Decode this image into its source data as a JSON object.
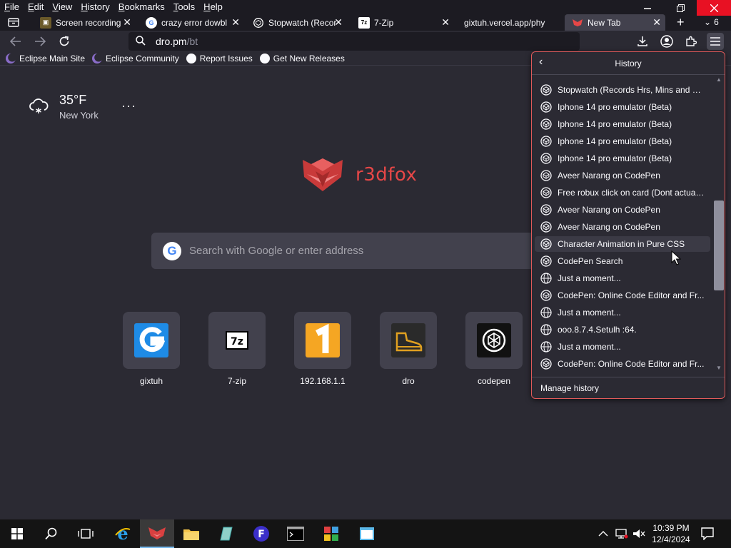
{
  "menu": [
    "File",
    "Edit",
    "View",
    "History",
    "Bookmarks",
    "Tools",
    "Help"
  ],
  "tabs": [
    {
      "title": "Screen recording",
      "icon": "screen-recording-icon"
    },
    {
      "title": "crazy error dowbl",
      "icon": "google-icon"
    },
    {
      "title": "Stopwatch (Recor",
      "icon": "codepen-icon"
    },
    {
      "title": "7-Zip",
      "icon": "7zip-icon"
    },
    {
      "title": "gixtuh.vercel.app/phy",
      "icon": ""
    },
    {
      "title": "New Tab",
      "icon": "r3dfox-icon",
      "active": true
    }
  ],
  "tab_overflow_count": "6",
  "urlbar": {
    "host": "dro.pm",
    "path": "/bt"
  },
  "bookmarks": [
    {
      "label": "Eclipse Main Site",
      "icon": "eclipse-icon"
    },
    {
      "label": "Eclipse Community",
      "icon": "eclipse-icon"
    },
    {
      "label": "Report Issues",
      "icon": "github-icon"
    },
    {
      "label": "Get New Releases",
      "icon": "github-icon"
    }
  ],
  "weather": {
    "temp": "35°F",
    "city": "New York",
    "more": "···"
  },
  "logo_text": "r3dfox",
  "search": {
    "placeholder": "Search with Google or enter address"
  },
  "top_sites": [
    {
      "label": "gixtuh",
      "icon": "gixtuh-icon"
    },
    {
      "label": "7-zip",
      "icon": "7zip-icon"
    },
    {
      "label": "192.168.1.1",
      "icon": "number-one-icon"
    },
    {
      "label": "dro",
      "icon": "shoe-icon"
    },
    {
      "label": "codepen",
      "icon": "codepen-icon"
    }
  ],
  "history": {
    "title": "History",
    "items": [
      {
        "title": "Stopwatch (Records Hrs, Mins and Se...",
        "icon": "codepen"
      },
      {
        "title": "Iphone 14 pro emulator (Beta)",
        "icon": "codepen"
      },
      {
        "title": "Iphone 14 pro emulator (Beta)",
        "icon": "codepen"
      },
      {
        "title": "Iphone 14 pro emulator (Beta)",
        "icon": "codepen"
      },
      {
        "title": "Iphone 14 pro emulator (Beta)",
        "icon": "codepen"
      },
      {
        "title": "Aveer Narang on CodePen",
        "icon": "codepen"
      },
      {
        "title": "Free robux click on card (Dont actuall...",
        "icon": "codepen"
      },
      {
        "title": "Aveer Narang on CodePen",
        "icon": "codepen"
      },
      {
        "title": "Aveer Narang on CodePen",
        "icon": "codepen"
      },
      {
        "title": "Character Animation in Pure CSS",
        "icon": "codepen",
        "hover": true
      },
      {
        "title": "CodePen Search",
        "icon": "codepen"
      },
      {
        "title": "Just a moment...",
        "icon": "globe"
      },
      {
        "title": "CodePen: Online Code Editor and Fr...",
        "icon": "codepen"
      },
      {
        "title": "Just a moment...",
        "icon": "globe"
      },
      {
        "title": "ooo.8.7.4.Setulh :64.",
        "icon": "globe"
      },
      {
        "title": "Just a moment...",
        "icon": "globe"
      },
      {
        "title": "CodePen: Online Code Editor and Fr...",
        "icon": "codepen"
      }
    ],
    "manage": "Manage history"
  },
  "clock": {
    "time": "10:39 PM",
    "date": "12/4/2024"
  },
  "colors": {
    "accent": "#e64747",
    "panel_border": "#e05a5a",
    "bg": "#2b2a33"
  }
}
